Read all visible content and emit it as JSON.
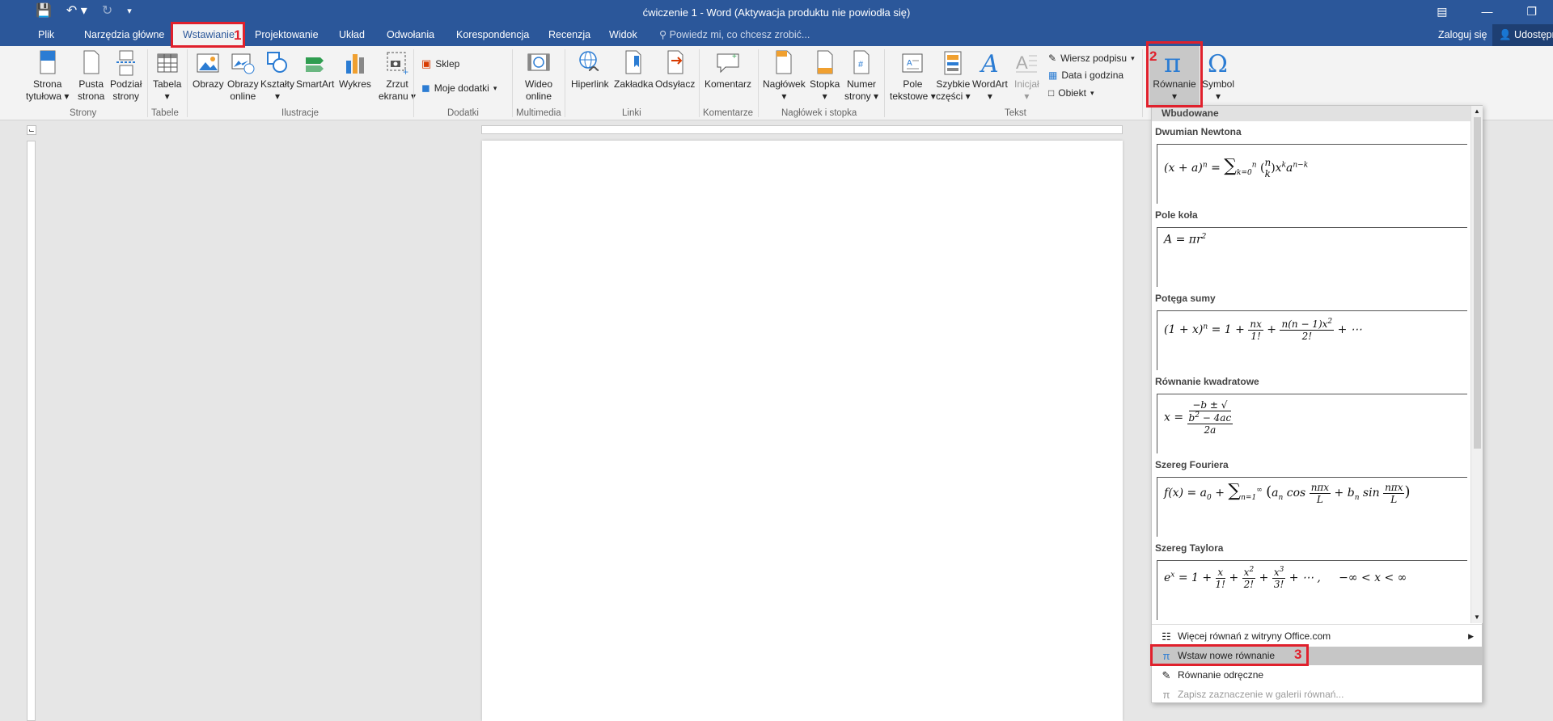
{
  "window": {
    "title": "ćwiczenie 1 - Word (Aktywacja produktu nie powiodła się)"
  },
  "tabs": [
    "Plik",
    "Narzędzia główne",
    "Wstawianie",
    "Projektowanie",
    "Układ",
    "Odwołania",
    "Korespondencja",
    "Recenzja",
    "Widok"
  ],
  "tellme": "Powiedz mi, co chcesz zrobić...",
  "account": {
    "signin": "Zaloguj się",
    "share": "Udostępnij"
  },
  "ribbon": {
    "strony": {
      "b1": [
        "Strona",
        "tytułowa"
      ],
      "b2": [
        "Pusta",
        "strona"
      ],
      "b3": [
        "Podział",
        "strony"
      ],
      "label": "Strony"
    },
    "tabele": {
      "b1": "Tabela",
      "label": "Tabele"
    },
    "ilustracje": {
      "b1": "Obrazy",
      "b2": [
        "Obrazy",
        "online"
      ],
      "b3": "Kształty",
      "b4": "SmartArt",
      "b5": "Wykres",
      "b6": [
        "Zrzut",
        "ekranu"
      ],
      "label": "Ilustracje"
    },
    "dodatki": {
      "b1": "Sklep",
      "b2": "Moje dodatki",
      "label": "Dodatki"
    },
    "multimedia": {
      "b1": [
        "Wideo",
        "online"
      ],
      "label": "Multimedia"
    },
    "linki": {
      "b1": "Hiperlink",
      "b2": "Zakładka",
      "b3": "Odsyłacz",
      "label": "Linki"
    },
    "komentarze": {
      "b1": "Komentarz",
      "label": "Komentarze"
    },
    "naglowek": {
      "b1": "Nagłówek",
      "b2": "Stopka",
      "b3": [
        "Numer",
        "strony"
      ],
      "label": "Nagłówek i stopka"
    },
    "tekst": {
      "b1": [
        "Pole",
        "tekstowe"
      ],
      "b2": [
        "Szybkie",
        "części"
      ],
      "b3": "WordArt",
      "b4": "Inicjał",
      "s1": "Wiersz podpisu",
      "s2": "Data i godzina",
      "s3": "Obiekt",
      "label": "Tekst"
    },
    "symbole": {
      "b1": "Równanie",
      "b2": "Symbol"
    }
  },
  "gallery": {
    "header": "Wbudowane",
    "equations": [
      {
        "title": "Dwumian Newtona"
      },
      {
        "title": "Pole koła"
      },
      {
        "title": "Potęga sumy"
      },
      {
        "title": "Równanie kwadratowe"
      },
      {
        "title": "Szereg Fouriera"
      },
      {
        "title": "Szereg Taylora"
      }
    ],
    "menu": [
      "Więcej równań z witryny Office.com",
      "Wstaw nowe równanie",
      "Równanie odręczne",
      "Zapisz zaznaczenie w galerii równań..."
    ]
  },
  "annotations": [
    "1",
    "2",
    "3"
  ],
  "colors": {
    "accent": "#2b579a",
    "highlight": "#e0202c"
  }
}
